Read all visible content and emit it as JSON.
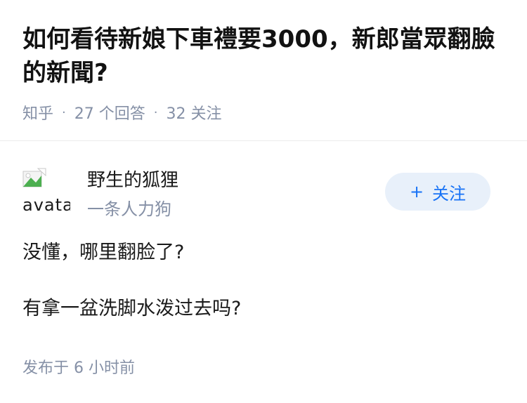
{
  "question": {
    "title": "如何看待新娘下車禮要3000，新郎當眾翻臉的新聞?",
    "source": "知乎",
    "answers_count": "27 个回答",
    "followers_count": "32 关注"
  },
  "author": {
    "avatar_alt": "avatar",
    "name": "野生的狐狸",
    "headline": "一条人力狗",
    "follow_label": "关注",
    "follow_icon": "plus-icon"
  },
  "answer": {
    "paragraphs": [
      "没懂，哪里翻脸了?",
      "有拿一盆洗脚水泼过去吗?"
    ],
    "published": "发布于 6 小时前"
  },
  "colors": {
    "title": "#121212",
    "meta": "#8590a6",
    "follow_bg": "#e8f0fa",
    "follow_text": "#1772f6",
    "divider": "#ebebeb"
  }
}
